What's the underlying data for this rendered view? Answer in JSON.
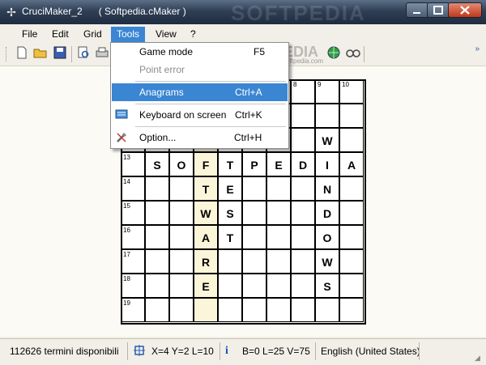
{
  "window": {
    "app_title": "CruciMaker_2",
    "doc_title": "( Softpedia.cMaker )",
    "watermark": "SOFTPEDIA"
  },
  "menu": {
    "file": "File",
    "edit": "Edit",
    "grid": "Grid",
    "tools": "Tools",
    "view": "View",
    "help": "?"
  },
  "tools_menu": [
    {
      "label": "Game mode",
      "shortcut": "F5",
      "state": "normal",
      "icon": ""
    },
    {
      "label": "Point error",
      "shortcut": "",
      "state": "disabled",
      "icon": ""
    },
    {
      "label": "Anagrams",
      "shortcut": "Ctrl+A",
      "state": "hover",
      "icon": ""
    },
    {
      "label": "Keyboard on screen",
      "shortcut": "Ctrl+K",
      "state": "normal",
      "icon": "keyboard-icon"
    },
    {
      "label": "Option...",
      "shortcut": "Ctrl+H",
      "state": "normal",
      "icon": "tools-icon"
    }
  ],
  "toolbar_overlay": "www.softpedia.com",
  "grid": {
    "rows": 10,
    "cols": 10,
    "highlight_col": 4,
    "col_numbers": {
      "8": "8",
      "9": "9",
      "10": "10"
    },
    "row_numbers": {
      "4": "13",
      "5": "14",
      "6": "15",
      "7": "16",
      "8": "17",
      "9": "18",
      "10": "19"
    },
    "letters": [
      {
        "r": 3,
        "c": 9,
        "ch": "W"
      },
      {
        "r": 4,
        "c": 2,
        "ch": "S"
      },
      {
        "r": 4,
        "c": 3,
        "ch": "O"
      },
      {
        "r": 4,
        "c": 4,
        "ch": "F"
      },
      {
        "r": 4,
        "c": 5,
        "ch": "T"
      },
      {
        "r": 4,
        "c": 6,
        "ch": "P"
      },
      {
        "r": 4,
        "c": 7,
        "ch": "E"
      },
      {
        "r": 4,
        "c": 8,
        "ch": "D"
      },
      {
        "r": 4,
        "c": 9,
        "ch": "I"
      },
      {
        "r": 4,
        "c": 10,
        "ch": "A"
      },
      {
        "r": 5,
        "c": 4,
        "ch": "T"
      },
      {
        "r": 5,
        "c": 5,
        "ch": "E"
      },
      {
        "r": 5,
        "c": 9,
        "ch": "N"
      },
      {
        "r": 6,
        "c": 4,
        "ch": "W"
      },
      {
        "r": 6,
        "c": 5,
        "ch": "S"
      },
      {
        "r": 6,
        "c": 9,
        "ch": "D"
      },
      {
        "r": 7,
        "c": 4,
        "ch": "A"
      },
      {
        "r": 7,
        "c": 5,
        "ch": "T"
      },
      {
        "r": 7,
        "c": 9,
        "ch": "O"
      },
      {
        "r": 8,
        "c": 4,
        "ch": "R"
      },
      {
        "r": 8,
        "c": 9,
        "ch": "W"
      },
      {
        "r": 9,
        "c": 4,
        "ch": "E"
      },
      {
        "r": 9,
        "c": 9,
        "ch": "S"
      }
    ]
  },
  "status": {
    "terms": "112626 termini disponibili",
    "coords": "X=4  Y=2  L=10",
    "stats": "B=0  L=25  V=75",
    "language": "English (United States)"
  },
  "colors": {
    "accent": "#3a86d2",
    "highlight": "#fbf6d9"
  }
}
